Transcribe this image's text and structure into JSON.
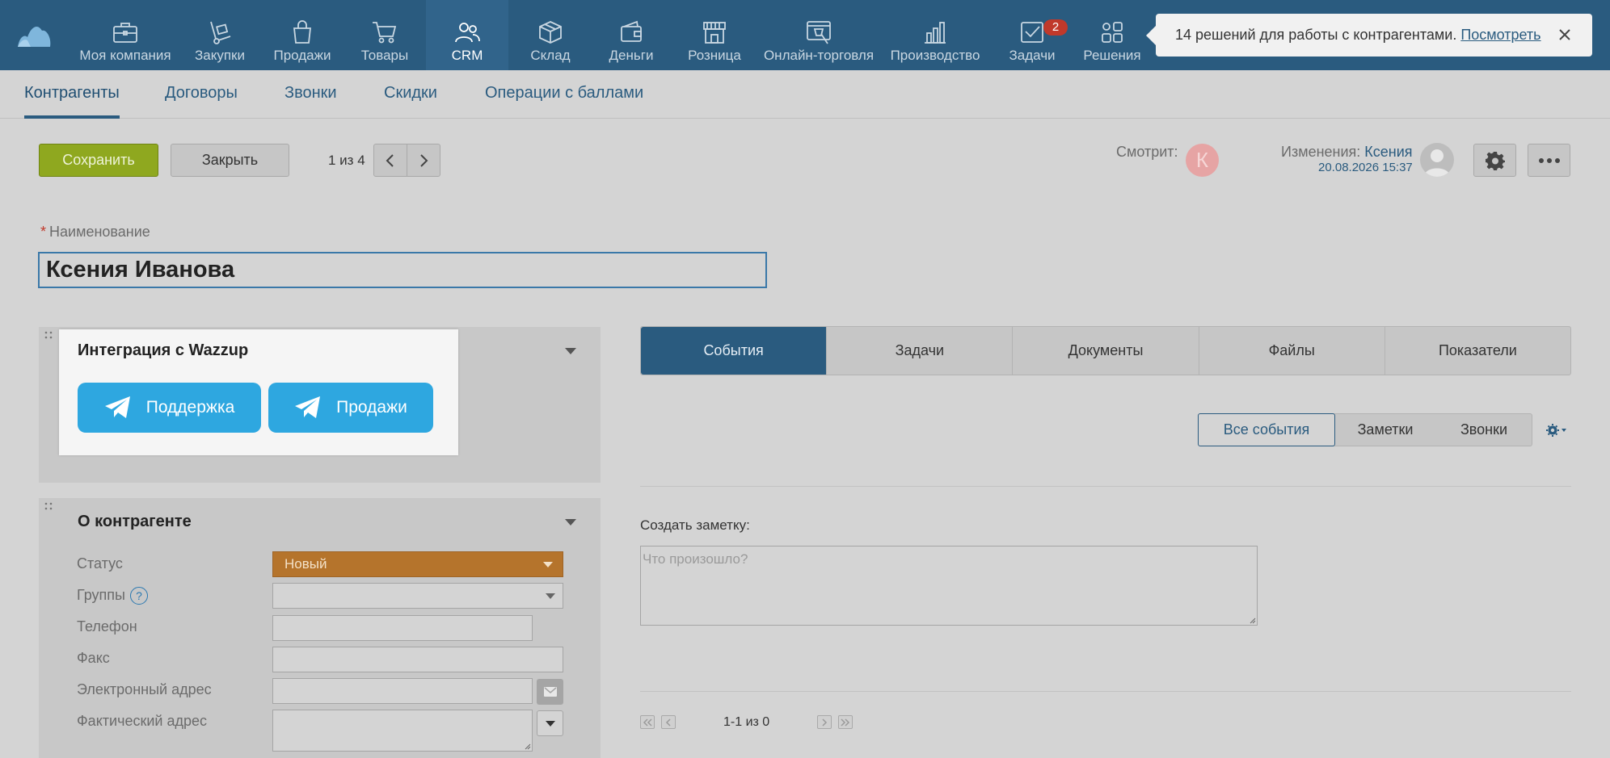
{
  "top_nav": {
    "items": [
      {
        "label": "Моя компания",
        "icon": "briefcase-icon"
      },
      {
        "label": "Закупки",
        "icon": "hand-truck-icon"
      },
      {
        "label": "Продажи",
        "icon": "shopping-bag-icon"
      },
      {
        "label": "Товары",
        "icon": "cart-icon"
      },
      {
        "label": "CRM",
        "icon": "people-icon"
      },
      {
        "label": "Склад",
        "icon": "box-icon"
      },
      {
        "label": "Деньги",
        "icon": "wallet-icon"
      },
      {
        "label": "Розница",
        "icon": "store-icon"
      },
      {
        "label": "Онлайн-торговля",
        "icon": "online-store-icon"
      },
      {
        "label": "Производство",
        "icon": "bar-chart-icon"
      },
      {
        "label": "Задачи",
        "icon": "tasks-check-icon",
        "badge": "2"
      },
      {
        "label": "Решения",
        "icon": "apps-grid-icon"
      }
    ],
    "active": "CRM"
  },
  "notification": {
    "text": "14 решений для работы с контрагентами.",
    "link": "Посмотреть"
  },
  "sub_nav": {
    "tabs": [
      "Контрагенты",
      "Договоры",
      "Звонки",
      "Скидки",
      "Операции с баллами"
    ],
    "active": "Контрагенты"
  },
  "toolbar": {
    "save_label": "Сохранить",
    "close_label": "Закрыть",
    "pager": "1 из 4",
    "watching_label": "Смотрит:",
    "watching_initial": "К",
    "changes_label": "Изменения:",
    "changes_user": "Ксения",
    "changes_date": "20.08.2026 15:37"
  },
  "form": {
    "name_label": "Наименование",
    "name_value": "Ксения Иванова"
  },
  "wazzup": {
    "title": "Интеграция с Wazzup",
    "buttons": [
      "Поддержка",
      "Продажи"
    ]
  },
  "about": {
    "title": "О контрагенте",
    "fields": {
      "status": "Статус",
      "groups": "Группы",
      "phone": "Телефон",
      "fax": "Факс",
      "email": "Электронный адрес",
      "address": "Фактический адрес"
    },
    "status_value": "Новый",
    "groups_help": "?"
  },
  "right_tabs": [
    "События",
    "Задачи",
    "Документы",
    "Файлы",
    "Показатели"
  ],
  "right_tabs_active": "События",
  "event_filter": [
    "Все события",
    "Заметки",
    "Звонки"
  ],
  "note": {
    "label": "Создать заметку:",
    "placeholder": "Что произошло?"
  },
  "pagination": "1-1 из 0",
  "colors": {
    "nav_bg": "#2a5b7f",
    "save_btn": "#8fa81f",
    "status_new": "#b5742c",
    "telegram": "#2ea7e0",
    "badge": "#c0392b"
  }
}
